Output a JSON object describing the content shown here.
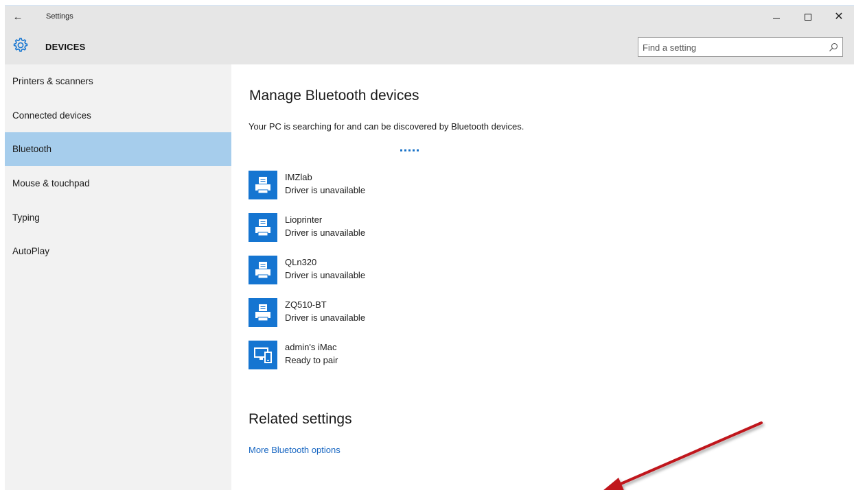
{
  "window": {
    "title": "Settings",
    "back_icon": "back-arrow-icon",
    "controls": [
      "minimize-icon",
      "maximize-icon",
      "close-icon"
    ]
  },
  "header": {
    "section": "DEVICES",
    "icon": "gear-icon",
    "search_placeholder": "Find a setting",
    "search_icon": "search-icon"
  },
  "sidebar": {
    "items": [
      {
        "label": "Printers & scanners",
        "active": false
      },
      {
        "label": "Connected devices",
        "active": false
      },
      {
        "label": "Bluetooth",
        "active": true
      },
      {
        "label": "Mouse & touchpad",
        "active": false
      },
      {
        "label": "Typing",
        "active": false
      },
      {
        "label": "AutoPlay",
        "active": false
      }
    ]
  },
  "main": {
    "title": "Manage Bluetooth devices",
    "status": "Your PC is searching for and can be discovered by Bluetooth devices.",
    "devices": [
      {
        "name": "IMZlab",
        "status": "Driver is unavailable",
        "icon": "printer-icon"
      },
      {
        "name": "Lioprinter",
        "status": "Driver is unavailable",
        "icon": "printer-icon"
      },
      {
        "name": "QLn320",
        "status": "Driver is unavailable",
        "icon": "printer-icon"
      },
      {
        "name": "ZQ510-BT",
        "status": "Driver is unavailable",
        "icon": "printer-icon"
      },
      {
        "name": "admin's iMac",
        "status": "Ready to pair",
        "icon": "computer-phone-icon"
      }
    ],
    "related_title": "Related settings",
    "related_link": "More Bluetooth options"
  },
  "colors": {
    "accent": "#1575d1",
    "selected": "#a6cdec",
    "link": "#1766c2",
    "annotation": "#c0171d"
  }
}
